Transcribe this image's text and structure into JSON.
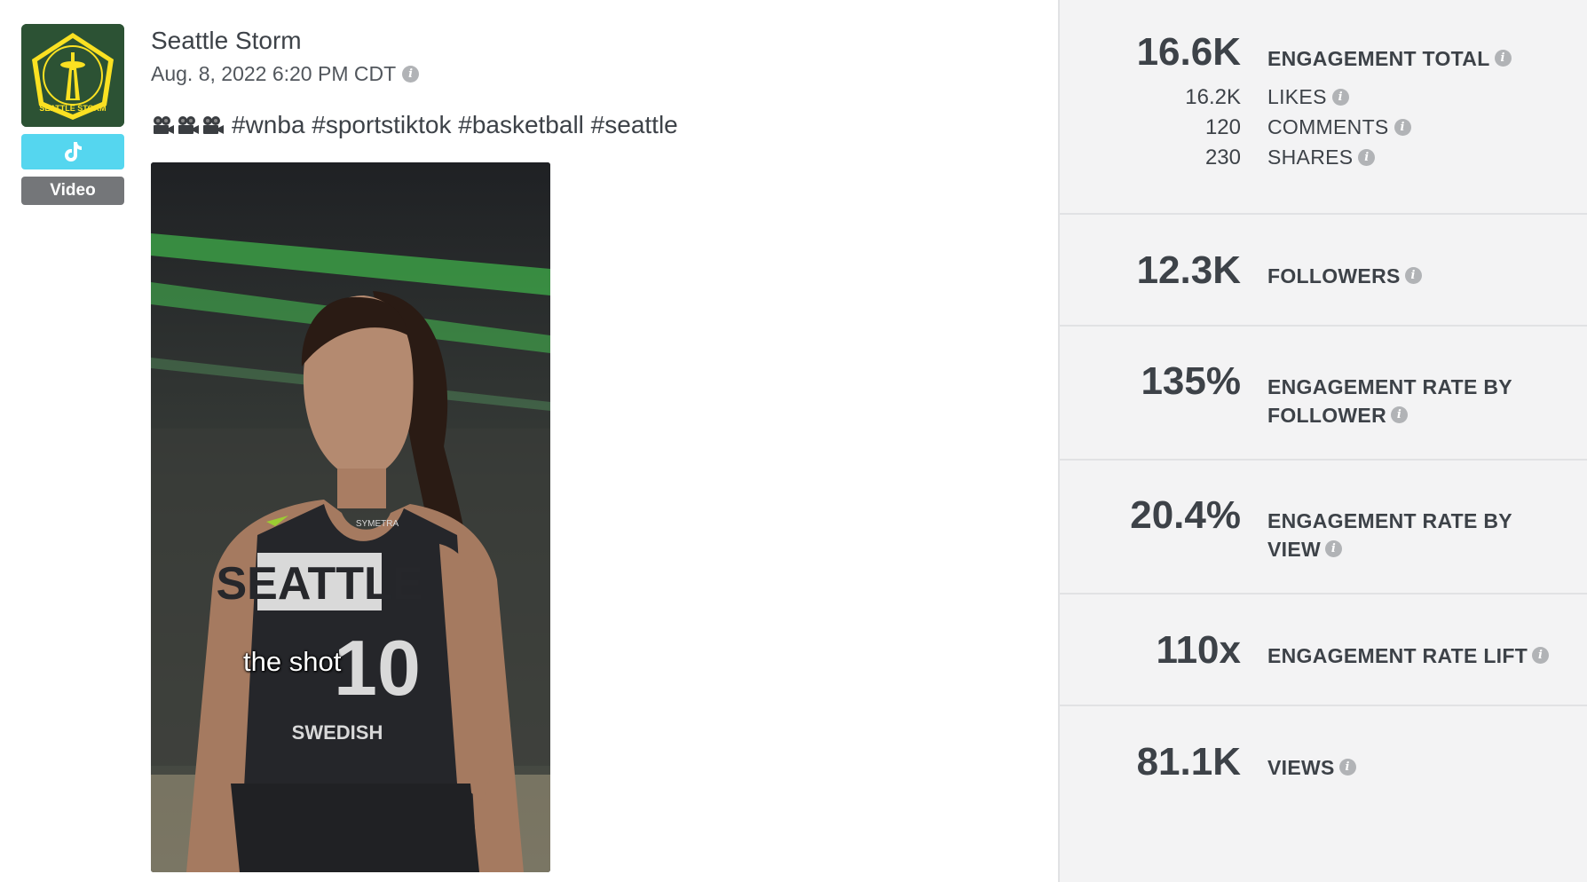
{
  "post": {
    "account_name": "Seattle Storm",
    "date": "Aug. 8, 2022 6:20 PM CDT",
    "network_icon": "tiktok-icon",
    "type_badge": "Video",
    "caption_emojis": [
      "movie-camera-icon",
      "movie-camera-icon",
      "movie-camera-icon"
    ],
    "caption_text": "#wnba #sportstiktok #basketball #seattle",
    "thumbnail_caption": "the shot",
    "logo_text": "SEATTLE STORM"
  },
  "metrics": {
    "engagement_total": {
      "value": "16.6K",
      "label": "ENGAGEMENT TOTAL",
      "breakdown": [
        {
          "value": "16.2K",
          "label": "LIKES"
        },
        {
          "value": "120",
          "label": "COMMENTS"
        },
        {
          "value": "230",
          "label": "SHARES"
        }
      ]
    },
    "followers": {
      "value": "12.3K",
      "label": "FOLLOWERS"
    },
    "engagement_rate_follower": {
      "value": "135%",
      "label_line1": "ENGAGEMENT RATE BY",
      "label_line2": "FOLLOWER"
    },
    "engagement_rate_view": {
      "value": "20.4%",
      "label_line1": "ENGAGEMENT RATE BY",
      "label_line2": "VIEW"
    },
    "engagement_rate_lift": {
      "value": "110x",
      "label": "ENGAGEMENT RATE LIFT"
    },
    "views": {
      "value": "81.1K",
      "label": "VIEWS"
    }
  },
  "colors": {
    "tiktok_badge": "#55d6ef",
    "video_badge": "#747679",
    "panel_bg": "#f3f3f4",
    "text": "#3d4248",
    "logo_green": "#2c5234",
    "logo_yellow": "#fbe122"
  }
}
